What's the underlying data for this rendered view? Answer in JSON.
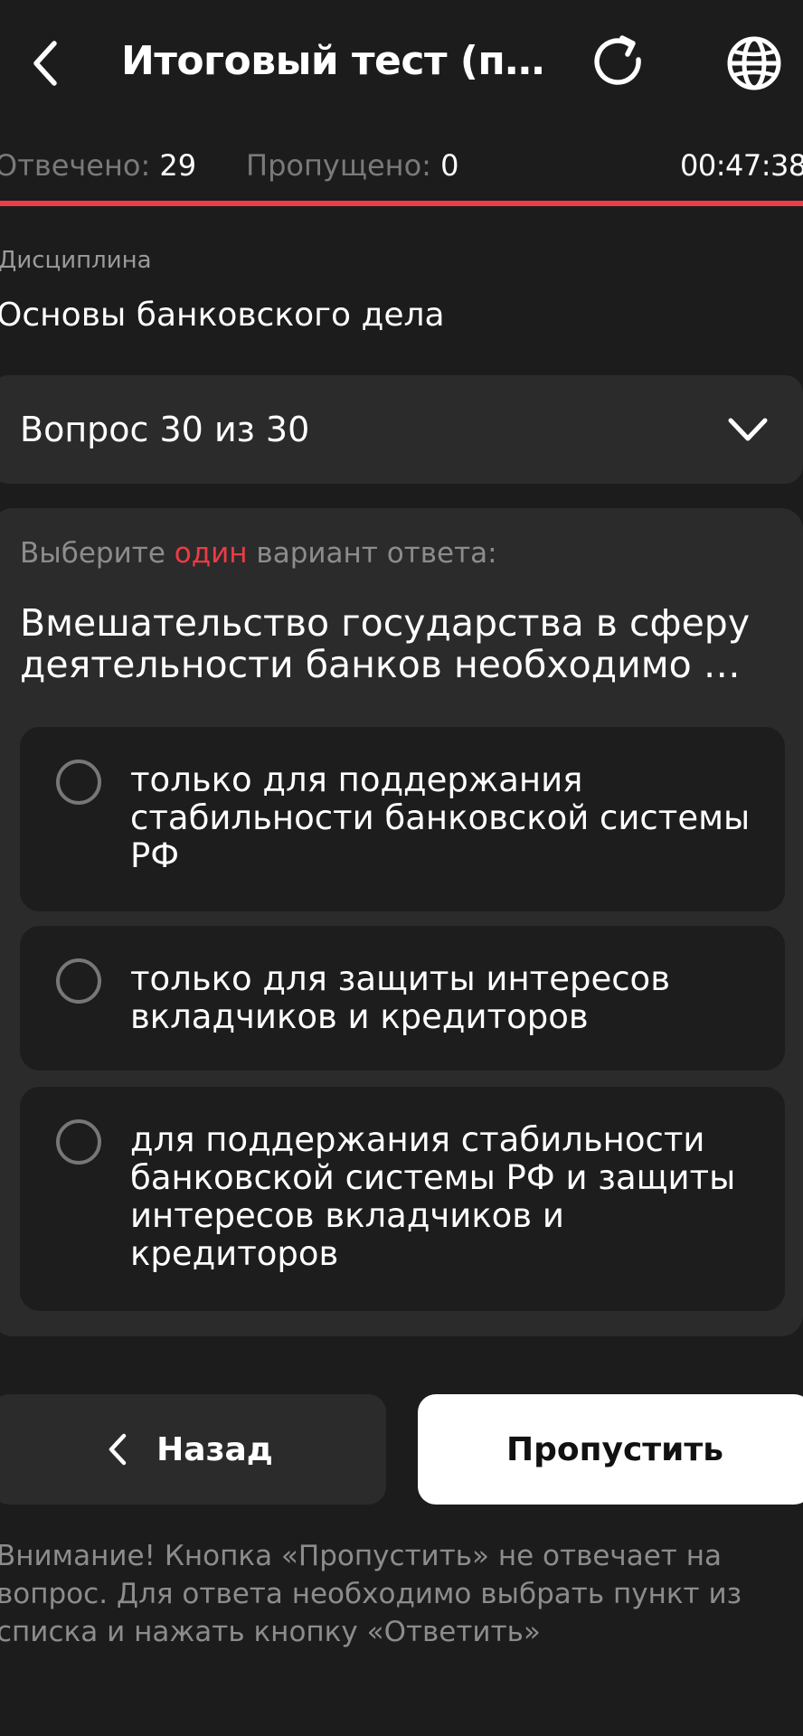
{
  "header": {
    "title": "Итоговый тест (пе…",
    "back_icon": "chevron-left-icon",
    "reload_icon": "reload-icon",
    "globe_icon": "globe-icon"
  },
  "stats": {
    "answered_label": "Отвечено:",
    "answered_value": "29",
    "skipped_label": "Пропущено:",
    "skipped_value": "0",
    "timer": "00:47:38"
  },
  "discipline": {
    "label": "Дисциплина",
    "value": "Основы банковского дела"
  },
  "question_selector": {
    "label": "Вопрос 30 из 30"
  },
  "question": {
    "instruction_before": "Выберите ",
    "instruction_accent": "один",
    "instruction_after": " вариант ответа:",
    "text": "Вмешательство государства в сферу деятельности банков необходимо …",
    "options": [
      {
        "label": "только для поддержания стабильности банковской системы РФ"
      },
      {
        "label": "только для защиты интересов вкладчиков и кредиторов"
      },
      {
        "label": "для поддержания стабильности банковской системы РФ и защиты интересов вкладчиков и кредиторов"
      }
    ]
  },
  "buttons": {
    "back_label": "Назад",
    "skip_label": "Пропустить"
  },
  "notice": "Внимание! Кнопка «Пропустить» не отвечает на вопрос. Для ответа необходимо выбрать пункт из списка и нажать кнопку «Ответить»",
  "colors": {
    "background": "#1c1c1c",
    "card": "#2b2b2b",
    "accent": "#ee3b45"
  }
}
